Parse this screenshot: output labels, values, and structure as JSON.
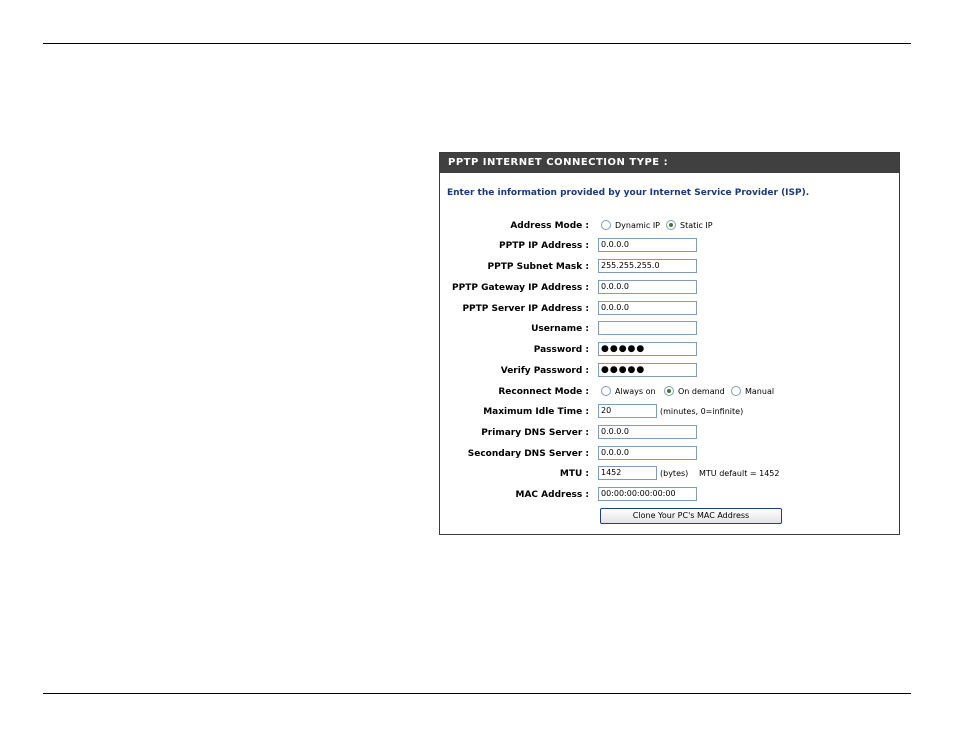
{
  "panel": {
    "title": "PPTP INTERNET CONNECTION TYPE :",
    "intro": "Enter the information provided by your Internet Service Provider (ISP)."
  },
  "address_mode": {
    "label": "Address Mode :",
    "options": [
      "Dynamic IP",
      "Static IP"
    ],
    "selected": "Static IP"
  },
  "fields": {
    "pptp_ip": {
      "label": "PPTP IP Address :",
      "value": "0.0.0.0"
    },
    "pptp_mask": {
      "label": "PPTP Subnet Mask :",
      "value": "255.255.255.0"
    },
    "pptp_gateway": {
      "label": "PPTP Gateway IP Address :",
      "value": "0.0.0.0"
    },
    "pptp_server": {
      "label": "PPTP Server IP Address :",
      "value": "0.0.0.0"
    },
    "username": {
      "label": "Username :",
      "value": ""
    },
    "password": {
      "label": "Password :",
      "value": "●●●●●"
    },
    "verify_password": {
      "label": "Verify Password :",
      "value": "●●●●●"
    },
    "max_idle": {
      "label": "Maximum Idle Time :",
      "value": "20",
      "note": "(minutes, 0=infinite)"
    },
    "primary_dns": {
      "label": "Primary DNS Server :",
      "value": "0.0.0.0"
    },
    "secondary_dns": {
      "label": "Secondary DNS Server :",
      "value": "0.0.0.0"
    },
    "mtu": {
      "label": "MTU :",
      "value": "1452",
      "note": "(bytes)",
      "default_note": "MTU default = 1452"
    },
    "mac": {
      "label": "MAC Address :",
      "value": "00:00:00:00:00:00"
    }
  },
  "reconnect_mode": {
    "label": "Reconnect Mode :",
    "options": [
      "Always on",
      "On demand",
      "Manual"
    ],
    "selected": "On demand"
  },
  "clone_button": "Clone Your PC's MAC Address"
}
